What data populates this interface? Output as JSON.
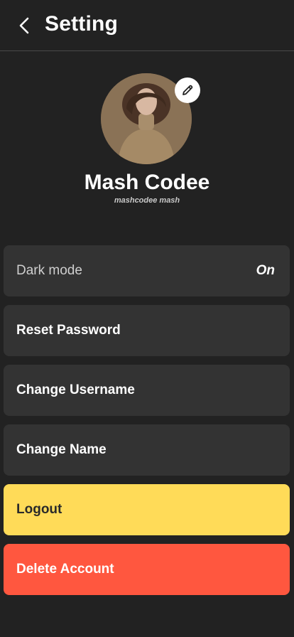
{
  "header": {
    "title": "Setting"
  },
  "profile": {
    "name": "Mash Codee",
    "handle": "mashcodee mash"
  },
  "settings": {
    "dark_mode_label": "Dark mode",
    "dark_mode_value": "On",
    "reset_password": "Reset Password",
    "change_username": "Change Username",
    "change_name": "Change Name",
    "logout": "Logout",
    "delete_account": "Delete Account"
  },
  "colors": {
    "background": "#222222",
    "card": "#333333",
    "logout": "#ffdb58",
    "delete": "#ff573f"
  },
  "icons": {
    "back": "chevron-left-icon",
    "edit": "pencil-icon"
  }
}
